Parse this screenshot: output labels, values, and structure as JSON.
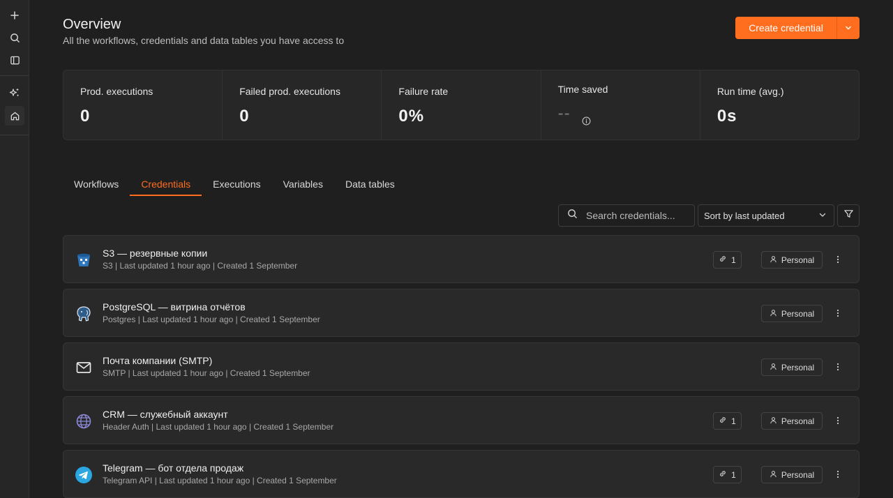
{
  "sidebar": {
    "items": [
      {
        "name": "add-icon"
      },
      {
        "name": "search-icon"
      },
      {
        "name": "panel-toggle-icon"
      },
      {
        "name": "sparkles-icon"
      },
      {
        "name": "home-icon"
      }
    ]
  },
  "header": {
    "title": "Overview",
    "subtitle": "All the workflows, credentials and data tables you have access to",
    "create_label": "Create credential"
  },
  "stats": [
    {
      "label": "Prod. executions",
      "value": "0"
    },
    {
      "label": "Failed prod. executions",
      "value": "0"
    },
    {
      "label": "Failure rate",
      "value": "0%"
    },
    {
      "label": "Time saved",
      "value": "--"
    },
    {
      "label": "Run time (avg.)",
      "value": "0s"
    }
  ],
  "tabs": [
    {
      "label": "Workflows",
      "active": false
    },
    {
      "label": "Credentials",
      "active": true
    },
    {
      "label": "Executions",
      "active": false
    },
    {
      "label": "Variables",
      "active": false
    },
    {
      "label": "Data tables",
      "active": false
    }
  ],
  "toolbar": {
    "search_placeholder": "Search credentials...",
    "sort_label": "Sort by last updated"
  },
  "credentials": [
    {
      "title": "S3 — резервные копии",
      "meta": "S3 | Last updated 1 hour ago | Created 1 September",
      "count": "1",
      "owner": "Personal",
      "icon": "s3-bucket-icon"
    },
    {
      "title": "PostgreSQL — витрина отчётов",
      "meta": "Postgres | Last updated 1 hour ago | Created 1 September",
      "count": null,
      "owner": "Personal",
      "icon": "postgres-elephant-icon"
    },
    {
      "title": "Почта компании (SMTP)",
      "meta": "SMTP | Last updated 1 hour ago | Created 1 September",
      "count": null,
      "owner": "Personal",
      "icon": "envelope-icon"
    },
    {
      "title": "CRM — служебный аккаунт",
      "meta": "Header Auth | Last updated 1 hour ago | Created 1 September",
      "count": "1",
      "owner": "Personal",
      "icon": "globe-icon"
    },
    {
      "title": "Telegram — бот отдела продаж",
      "meta": "Telegram API | Last updated 1 hour ago | Created 1 September",
      "count": "1",
      "owner": "Personal",
      "icon": "telegram-icon"
    }
  ],
  "colors": {
    "accent": "#ff6d1f",
    "background": "#1f1f1f",
    "card": "#292929"
  }
}
